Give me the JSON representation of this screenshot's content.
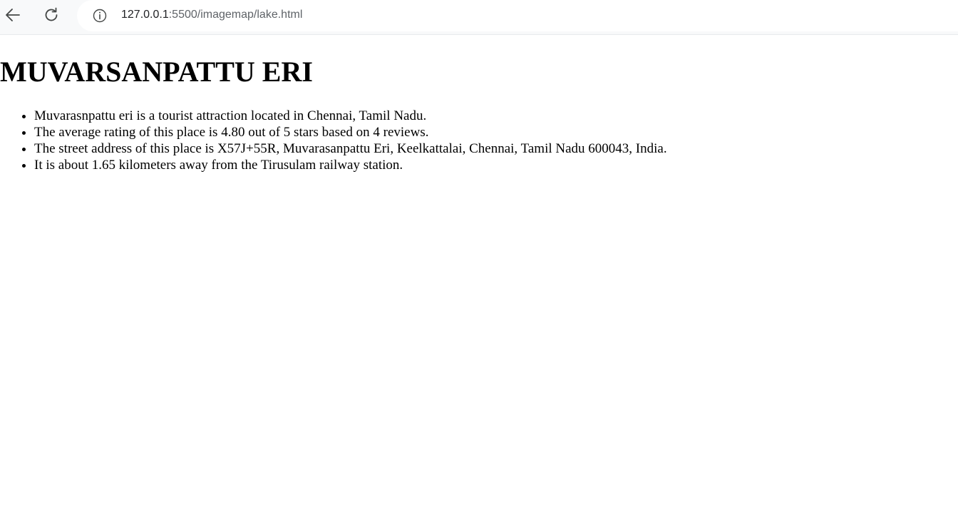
{
  "browser": {
    "url_host": "127.0.0.1",
    "url_path": ":5500/imagemap/lake.html",
    "icons": {
      "back": "arrow-left-icon",
      "reload": "reload-icon",
      "site_info": "info-icon"
    }
  },
  "page": {
    "title": "MUVARSANPATTU ERI",
    "facts": [
      "Muvarasnpattu eri is a tourist attraction located in Chennai, Tamil Nadu.",
      "The average rating of this place is 4.80 out of 5 stars based on 4 reviews.",
      "The street address of this place is X57J+55R, Muvarasanpattu Eri, Keelkattalai, Chennai, Tamil Nadu 600043, India.",
      "It is about 1.65 kilometers away from the Tirusulam railway station."
    ]
  },
  "colors": {
    "toolbar_bg": "#f8f9fa",
    "omnibox_bg": "#ffffff",
    "url_host": "#202124",
    "url_path": "#5f6368",
    "icon": "#444746",
    "text": "#000000"
  }
}
